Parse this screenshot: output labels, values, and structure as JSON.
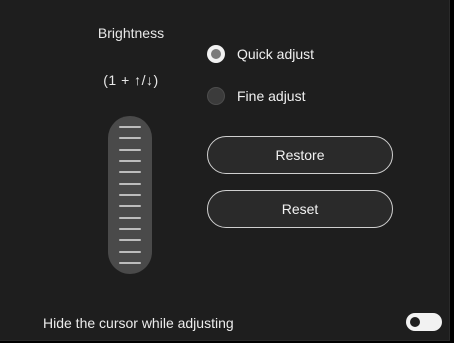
{
  "brightness": {
    "title": "Brightness",
    "hint": "(1 + ↑/↓)",
    "slider": {
      "notch_count": 13
    }
  },
  "mode": {
    "options": [
      {
        "label": "Quick adjust",
        "checked": true
      },
      {
        "label": "Fine adjust",
        "checked": false
      }
    ]
  },
  "buttons": {
    "restore_label": "Restore",
    "reset_label": "Reset"
  },
  "footer": {
    "hide_cursor_label": "Hide the cursor while adjusting",
    "hide_cursor_enabled": false
  },
  "colors": {
    "panel_bg": "#1e1e1e",
    "text": "#f2f2f2",
    "slider_bg": "#4a4a4a",
    "button_border": "#cfcfcf"
  }
}
